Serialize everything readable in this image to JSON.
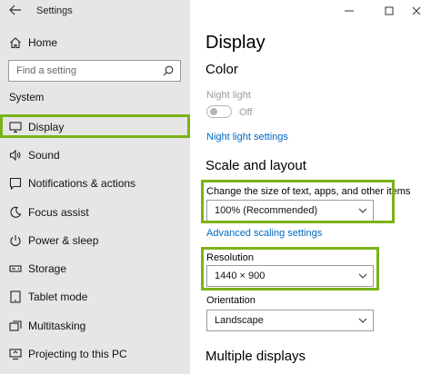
{
  "window": {
    "title": "Settings",
    "controls": [
      "minimize-icon",
      "maximize-icon",
      "close-icon"
    ]
  },
  "sidebar": {
    "home_label": "Home",
    "search_placeholder": "Find a setting",
    "section_label": "System",
    "items": [
      {
        "label": "Display",
        "icon": "monitor-icon",
        "selected": true
      },
      {
        "label": "Sound",
        "icon": "speaker-icon"
      },
      {
        "label": "Notifications & actions",
        "icon": "notifications-icon"
      },
      {
        "label": "Focus assist",
        "icon": "moon-icon"
      },
      {
        "label": "Power & sleep",
        "icon": "power-icon"
      },
      {
        "label": "Storage",
        "icon": "storage-icon"
      },
      {
        "label": "Tablet mode",
        "icon": "tablet-icon"
      },
      {
        "label": "Multitasking",
        "icon": "multitasking-icon"
      },
      {
        "label": "Projecting to this PC",
        "icon": "projecting-icon"
      }
    ]
  },
  "main": {
    "page_title": "Display",
    "color_heading": "Color",
    "night_light_label": "Night light",
    "night_light_state": "Off",
    "night_light_settings_link": "Night light settings",
    "scale_heading": "Scale and layout",
    "scale_label": "Change the size of text, apps, and other items",
    "scale_value": "100% (Recommended)",
    "advanced_scaling_link": "Advanced scaling settings",
    "resolution_label": "Resolution",
    "resolution_value": "1440 × 900",
    "orientation_label": "Orientation",
    "orientation_value": "Landscape",
    "multiple_displays_heading": "Multiple displays"
  },
  "colors": {
    "accent": "#0067c0",
    "highlight": "#7ab317",
    "sidebar_bg": "#e6e6e6"
  }
}
